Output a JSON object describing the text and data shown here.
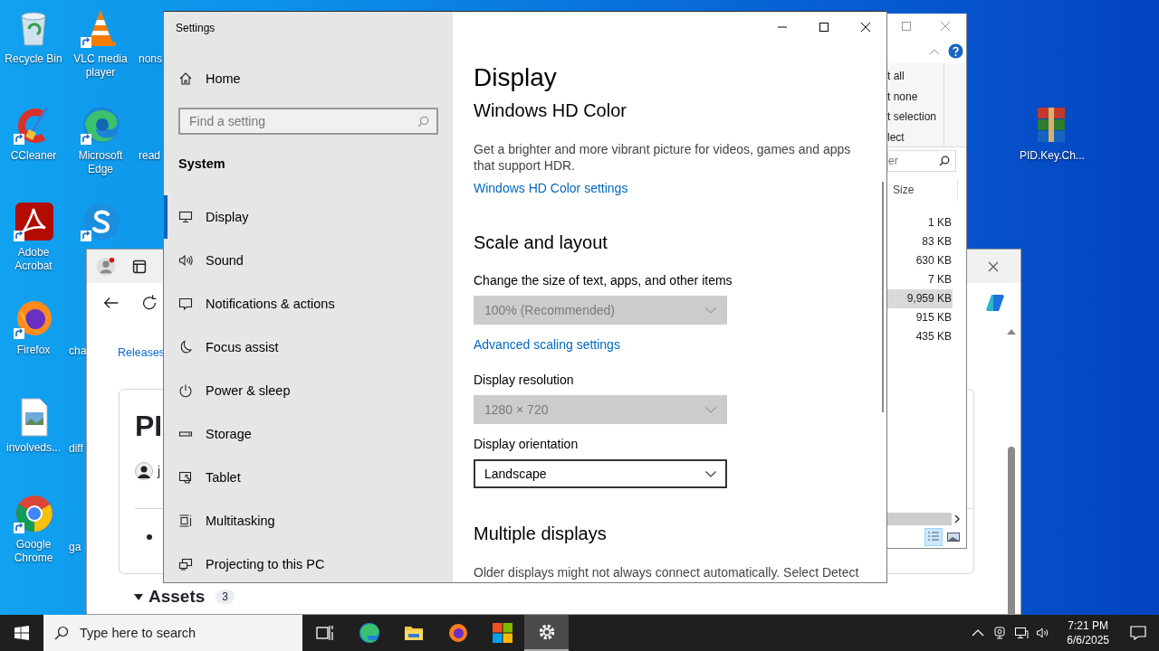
{
  "desktop_icons": [
    {
      "label": "Recycle Bin",
      "selected": false
    },
    {
      "label": "CCleaner",
      "selected": false
    },
    {
      "label": "Adobe Acrobat",
      "selected": false
    },
    {
      "label": "Firefox",
      "selected": false
    },
    {
      "label": "involveds...",
      "selected": false
    },
    {
      "label": "Google Chrome",
      "selected": false
    },
    {
      "label": "VLC media player",
      "selected": false
    },
    {
      "label": "Microsoft Edge",
      "selected": false
    },
    {
      "selected": false
    },
    {
      "label": "cha",
      "selected": false
    },
    {
      "label": "diff",
      "selected": false
    },
    {
      "label": "ga",
      "selected": false
    },
    {
      "label": "nons",
      "selected": false
    },
    {
      "label": "read",
      "selected": false
    },
    {
      "label": "PID.Key.Ch...",
      "selected": false
    }
  ],
  "browser": {
    "breadcrumb": "Releases",
    "heading": "PI",
    "author": "j",
    "assets": {
      "label": "Assets",
      "count": "3",
      "expanded": true
    }
  },
  "explorer": {
    "ribbon": [
      "t all",
      "t none",
      "t selection",
      "lect"
    ],
    "search": {
      "placeholder": "er"
    },
    "size_header": "Size",
    "sizes": [
      {
        "text": "1 KB",
        "selected": false
      },
      {
        "text": "83 KB",
        "selected": false
      },
      {
        "text": "630 KB",
        "selected": false
      },
      {
        "text": "7 KB",
        "selected": false
      },
      {
        "text": "9,959 KB",
        "selected": true
      },
      {
        "text": "915 KB",
        "selected": false
      },
      {
        "text": "435 KB",
        "selected": false
      }
    ]
  },
  "settings": {
    "title": "Settings",
    "home": "Home",
    "search": {
      "placeholder": "Find a setting"
    },
    "section": "System",
    "nav": [
      {
        "label": "Display",
        "selected": true
      },
      {
        "label": "Sound",
        "selected": false
      },
      {
        "label": "Notifications & actions",
        "selected": false
      },
      {
        "label": "Focus assist",
        "selected": false
      },
      {
        "label": "Power & sleep",
        "selected": false
      },
      {
        "label": "Storage",
        "selected": false
      },
      {
        "label": "Tablet",
        "selected": false
      },
      {
        "label": "Multitasking",
        "selected": false
      },
      {
        "label": "Projecting to this PC",
        "selected": false
      }
    ],
    "page_title": "Display",
    "content": [
      {
        "kind": "subheading",
        "text": "Windows HD Color"
      },
      {
        "kind": "paragraph",
        "text": "Get a brighter and more vibrant picture for videos, games and apps that support HDR."
      },
      {
        "kind": "link",
        "text": "Windows HD Color settings"
      },
      {
        "kind": "section",
        "text": "Scale and layout"
      },
      {
        "kind": "label",
        "text": "Change the size of text, apps, and other items"
      },
      {
        "kind": "dropdown",
        "value": "100% (Recommended)",
        "disabled": true
      },
      {
        "kind": "link",
        "text": "Advanced scaling settings"
      },
      {
        "kind": "label",
        "text": "Display resolution"
      },
      {
        "kind": "dropdown",
        "value": "1280 × 720",
        "disabled": true
      },
      {
        "kind": "label",
        "text": "Display orientation"
      },
      {
        "kind": "dropdown",
        "value": "Landscape",
        "disabled": false
      },
      {
        "kind": "section",
        "text": "Multiple displays"
      },
      {
        "kind": "paragraph",
        "text": "Older displays might not always connect automatically. Select Detect"
      }
    ]
  },
  "taskbar": {
    "search_placeholder": "Type here to search",
    "apps": [
      {
        "selected": false
      },
      {
        "selected": false
      },
      {
        "selected": false
      },
      {
        "selected": false
      },
      {
        "selected": false
      },
      {
        "selected": true
      }
    ],
    "time": "7:21 PM",
    "date": "6/6/2025"
  }
}
